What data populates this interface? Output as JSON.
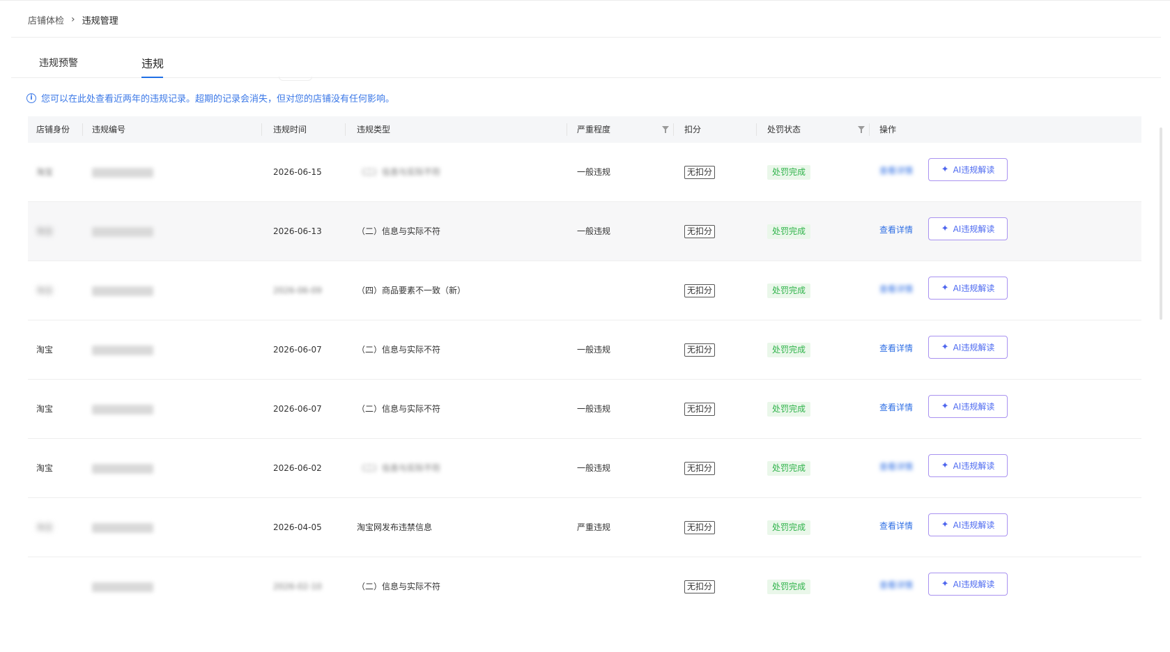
{
  "breadcrumb": {
    "parent": "店铺体检",
    "separator": "›",
    "current": "违规管理"
  },
  "tabs": [
    {
      "label": "违规预警",
      "active": false
    },
    {
      "label": "违规",
      "active": true
    }
  ],
  "notice": {
    "icon": "info-icon",
    "text": "您可以在此处查看近两年的违规记录。超期的记录会消失，但对您的店铺没有任何影响。"
  },
  "table": {
    "headers": {
      "shop_identity": "店铺身份",
      "violation_id": "违规编号",
      "violation_time": "违规时间",
      "violation_type": "违规类型",
      "severity": "严重程度",
      "deduction": "扣分",
      "penalty_status": "处罚状态",
      "actions": "操作"
    },
    "detail_label": "查看详情",
    "ai_label": "AI违规解读",
    "ai_icon": "sparkle-icon",
    "filter_icon": "filter-icon",
    "rows": [
      {
        "shop": "淘宝",
        "time": "2026-06-15",
        "type": "（二）信息与实际不符",
        "severity": "一般违规",
        "deduction": "无扣分",
        "status": "处罚完成"
      },
      {
        "shop": "淘宝",
        "time": "2026-06-13",
        "type": "（二）信息与实际不符",
        "severity": "一般违规",
        "deduction": "无扣分",
        "status": "处罚完成"
      },
      {
        "shop": "淘宝",
        "time": "2026-06-09",
        "type": "（四）商品要素不一致（新）",
        "severity": "",
        "deduction": "无扣分",
        "status": "处罚完成"
      },
      {
        "shop": "淘宝",
        "time": "2026-06-07",
        "type": "（二）信息与实际不符",
        "severity": "一般违规",
        "deduction": "无扣分",
        "status": "处罚完成"
      },
      {
        "shop": "淘宝",
        "time": "2026-06-07",
        "type": "（二）信息与实际不符",
        "severity": "一般违规",
        "deduction": "无扣分",
        "status": "处罚完成"
      },
      {
        "shop": "淘宝",
        "time": "2026-06-02",
        "type": "（二）信息与实际不符",
        "severity": "一般违规",
        "deduction": "无扣分",
        "status": "处罚完成"
      },
      {
        "shop": "淘宝",
        "time": "2026-04-05",
        "type": "淘宝网发布违禁信息",
        "severity": "严重违规",
        "deduction": "无扣分",
        "status": "处罚完成"
      },
      {
        "shop": "",
        "time": "2026-02-10",
        "type": "（二）信息与实际不符",
        "severity": "",
        "deduction": "无扣分",
        "status": "处罚完成"
      }
    ]
  },
  "colors": {
    "accent": "#1f6fe5",
    "link": "#2f6fe4",
    "success_text": "#2fb34a",
    "success_bg": "#eaf7ea",
    "ai_border": "#a992f0"
  }
}
